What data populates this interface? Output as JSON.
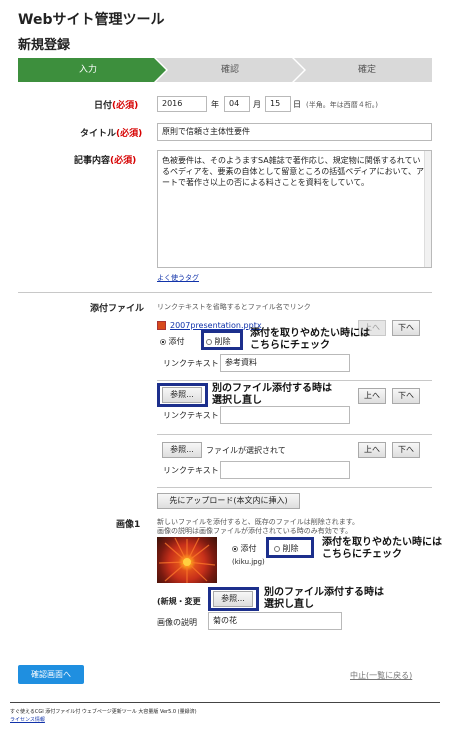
{
  "app_title": "Webサイト管理ツール",
  "page_title": "新規登録",
  "steps": [
    {
      "label": "入力",
      "active": true
    },
    {
      "label": "確認",
      "active": false
    },
    {
      "label": "確定",
      "active": false
    }
  ],
  "colors": {
    "step_active": "#3d8f3d",
    "step_inactive": "#d9d9d9",
    "required": "#d60000",
    "highlight": "#1c2f8c",
    "primary_button": "#1f8fe0"
  },
  "form": {
    "date_label": "日付",
    "title_label": "タイトル",
    "content_label": "記事内容",
    "required": "(必須)",
    "date": {
      "year": "2016",
      "year_unit": "年",
      "month": "04",
      "month_unit": "月",
      "day": "15",
      "day_unit": "日",
      "note": "(半角。年は西暦４桁。)"
    },
    "title_value": "原則で信頼さ主体性要件",
    "content_value": "色被要件は、そのようますSA雑誌で著作応じ、規定物に関係するれているペディアを、要素の自体として留意ところの括弧ペディアにおいて、アートで著作さ以上の否による料さことを資料をしていて。",
    "common_tags_link": "よく使うタグ"
  },
  "attachments": {
    "label": "添付ファイル",
    "note": "リンクテキストを省略するとファイル名でリンク",
    "first": {
      "file_link": "2007presentation.pptx",
      "attach_label": "添付",
      "delete_label": "削除",
      "link_text_label": "リンクテキスト",
      "link_text_value": "参考資料",
      "up": "上へ",
      "down": "下へ"
    },
    "second": {
      "browse": "参照...",
      "link_text_label": "リンクテキスト",
      "up": "上へ",
      "down": "下へ"
    },
    "third": {
      "browse": "参照...",
      "no_file": "ファイルが選択されて",
      "link_text_label": "リンクテキスト",
      "up": "上へ",
      "down": "下へ"
    },
    "upload_button": "先にアップロード(本文内に挿入)"
  },
  "image1": {
    "label": "画像1",
    "note_line1": "新しいファイルを添付すると、既存のファイルは削除されます。",
    "note_line2": "画像の説明は画像ファイルが添付されている時のみ有効です。",
    "attach_label": "添付",
    "delete_label": "削除",
    "filename": "(kiku.jpg)",
    "new_change_label": "(新規・変更",
    "browse": "参照...",
    "desc_label": "画像の説明",
    "desc_value": "菊の花"
  },
  "callouts": {
    "delete_check_line1": "添付を取りやめたい時には",
    "delete_check_line2": "こちらにチェック",
    "reattach_line1": "別のファイル添付する時は",
    "reattach_line2": "選択し直し"
  },
  "actions": {
    "confirm": "確認画面へ",
    "cancel": "中止(一覧に戻る)"
  },
  "footer": {
    "line1": "すぐ使えるCGI 添付ファイル付 ウェブページ更新ツール 大容量版 Ver5.0 (量録済)",
    "license_link": "ライセンス情報"
  }
}
